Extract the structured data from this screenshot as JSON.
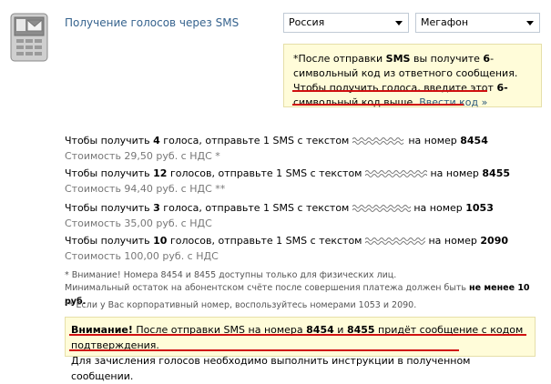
{
  "header": {
    "title": "Получение голосов через SMS"
  },
  "selects": {
    "country": "Россия",
    "operator": "Мегафон"
  },
  "note": {
    "prefix": "*После отправки ",
    "sms": "SMS",
    "middle": " вы получите ",
    "digits": "6",
    "suffix": "-символьный код из ответного сообщения.",
    "line2a": "Чтобы получить голоса, введите этот ",
    "line2b": "6-",
    "line3a": "символьный код выше.",
    "link": "Ввести код »"
  },
  "offers": [
    {
      "pre": "Чтобы получить ",
      "count": "4",
      "mid": " голоса, отправьте 1 SMS с текстом ",
      "post": " на номер ",
      "number": "8454",
      "cost": "Стоимость 29,50 руб. с НДС *"
    },
    {
      "pre": "Чтобы получить ",
      "count": "12",
      "mid": " голосов, отправьте 1 SMS с текстом ",
      "post": " на номер ",
      "number": "8455",
      "cost": "Стоимость 94,40 руб. с НДС **"
    },
    {
      "pre": "Чтобы получить ",
      "count": "3",
      "mid": " голоса, отправьте 1 SMS с текстом ",
      "post": " на номер ",
      "number": "1053",
      "cost": "Стоимость 35,00 руб. с НДС"
    },
    {
      "pre": "Чтобы получить ",
      "count": "10",
      "mid": " голосов, отправьте 1 SMS с текстом ",
      "post": " на номер ",
      "number": "2090",
      "cost": "Стоимость 100,00 руб. с НДС"
    }
  ],
  "footnotes": {
    "f1": "* Внимание! Номера 8454 и 8455 доступны только для физических лиц.",
    "f2a": "Минимальный остаток на абонентском счёте после совершения платежа должен быть ",
    "f2b": "не менее 10 руб.",
    "f3": "** Если у Вас корпоративный номер, воспользуйтесь номерами 1053 и 2090."
  },
  "warning": {
    "bold": "Внимание!",
    "t1": " После отправки SMS на номера ",
    "n1": "8454",
    "and": " и ",
    "n2": "8455",
    "t2": " придёт сообщение с кодом подтверждения.",
    "line2": "Для зачисления голосов необходимо выполнить инструкции в полученном сообщении."
  },
  "colors": {
    "accent": "#36638e",
    "note_bg": "#fffcd9",
    "underline": "#d01010"
  }
}
